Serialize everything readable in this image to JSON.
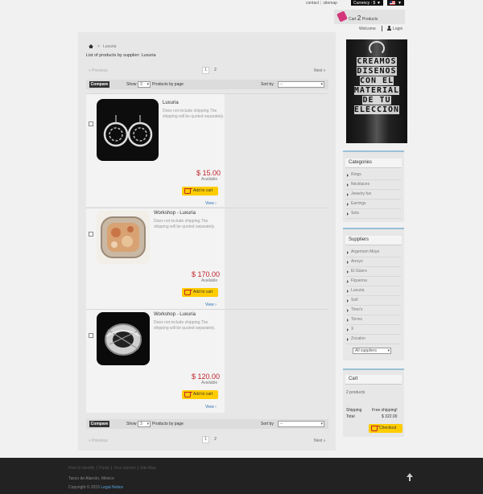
{
  "header": {
    "contact": "contact",
    "sitemap": "sitemap",
    "currency": "Currency : $",
    "cart_label": "Cart",
    "cart_count": "2",
    "cart_products": "Products",
    "welcome": "Welcome",
    "login": "Login"
  },
  "breadcrumb": {
    "current": "Luxuria",
    "sep": ">"
  },
  "page_title": "List of products by supplier: Luxuria",
  "pagination": {
    "prev": "« Previous",
    "pages": [
      "1",
      "2"
    ],
    "next": "Next »"
  },
  "toolbar": {
    "compare": "Compare",
    "show": "Show",
    "show_value": "3",
    "per_page": "Products by page",
    "sort_by": "Sort by",
    "sort_value": "--"
  },
  "products": [
    {
      "name": "Luxuria",
      "description": "Does not include shipping.The shipping will be quoted separately.",
      "price": "$ 15.00",
      "availability": "Available",
      "add_to_cart": "Add to cart",
      "view": "View"
    },
    {
      "name": "Workshop - Luxuria",
      "description": "Does not include shipping.The shipping will be quoted separately.",
      "price": "$ 170.00",
      "availability": "Available",
      "add_to_cart": "Add to cart",
      "view": "View"
    },
    {
      "name": "Workshop - Luxuria",
      "description": "Does not include shipping.The shipping will be quoted separately.",
      "price": "$ 120.00",
      "availability": "Available",
      "add_to_cart": "Add to cart",
      "view": "View"
    }
  ],
  "sidebar": {
    "banner_text": [
      "CREAMOS",
      "DISEÑOS",
      "CON EL",
      "MATERIAL",
      "DE TU",
      "ELECCIÓN"
    ],
    "categories_title": "Categories",
    "categories": [
      "Rings",
      "Necklaces",
      "Jewelry fun",
      "Earrings",
      "Sets"
    ],
    "suppliers_title": "Suppliers",
    "suppliers": [
      "Argentum Moye",
      "Arroyo",
      "El Güero",
      "Figueroa",
      "Luxuria",
      "Sofi",
      "Timo's",
      "Torres",
      "X",
      "Zocalon"
    ],
    "suppliers_select": "All suppliers",
    "cart_title": "Cart",
    "cart_products": "2 products",
    "shipping_label": "Shipping",
    "shipping_value": "Free shipping!",
    "total_label": "Total",
    "total_value": "$ 322.00",
    "checkout": "Checkout"
  },
  "footer": {
    "links": [
      "How to identify",
      "Purity",
      "Your opinion",
      "Site Map"
    ],
    "address": "Taxco de Alarcón, México",
    "copyright": "Copyright © 2015",
    "legal": "Legal Notice"
  }
}
